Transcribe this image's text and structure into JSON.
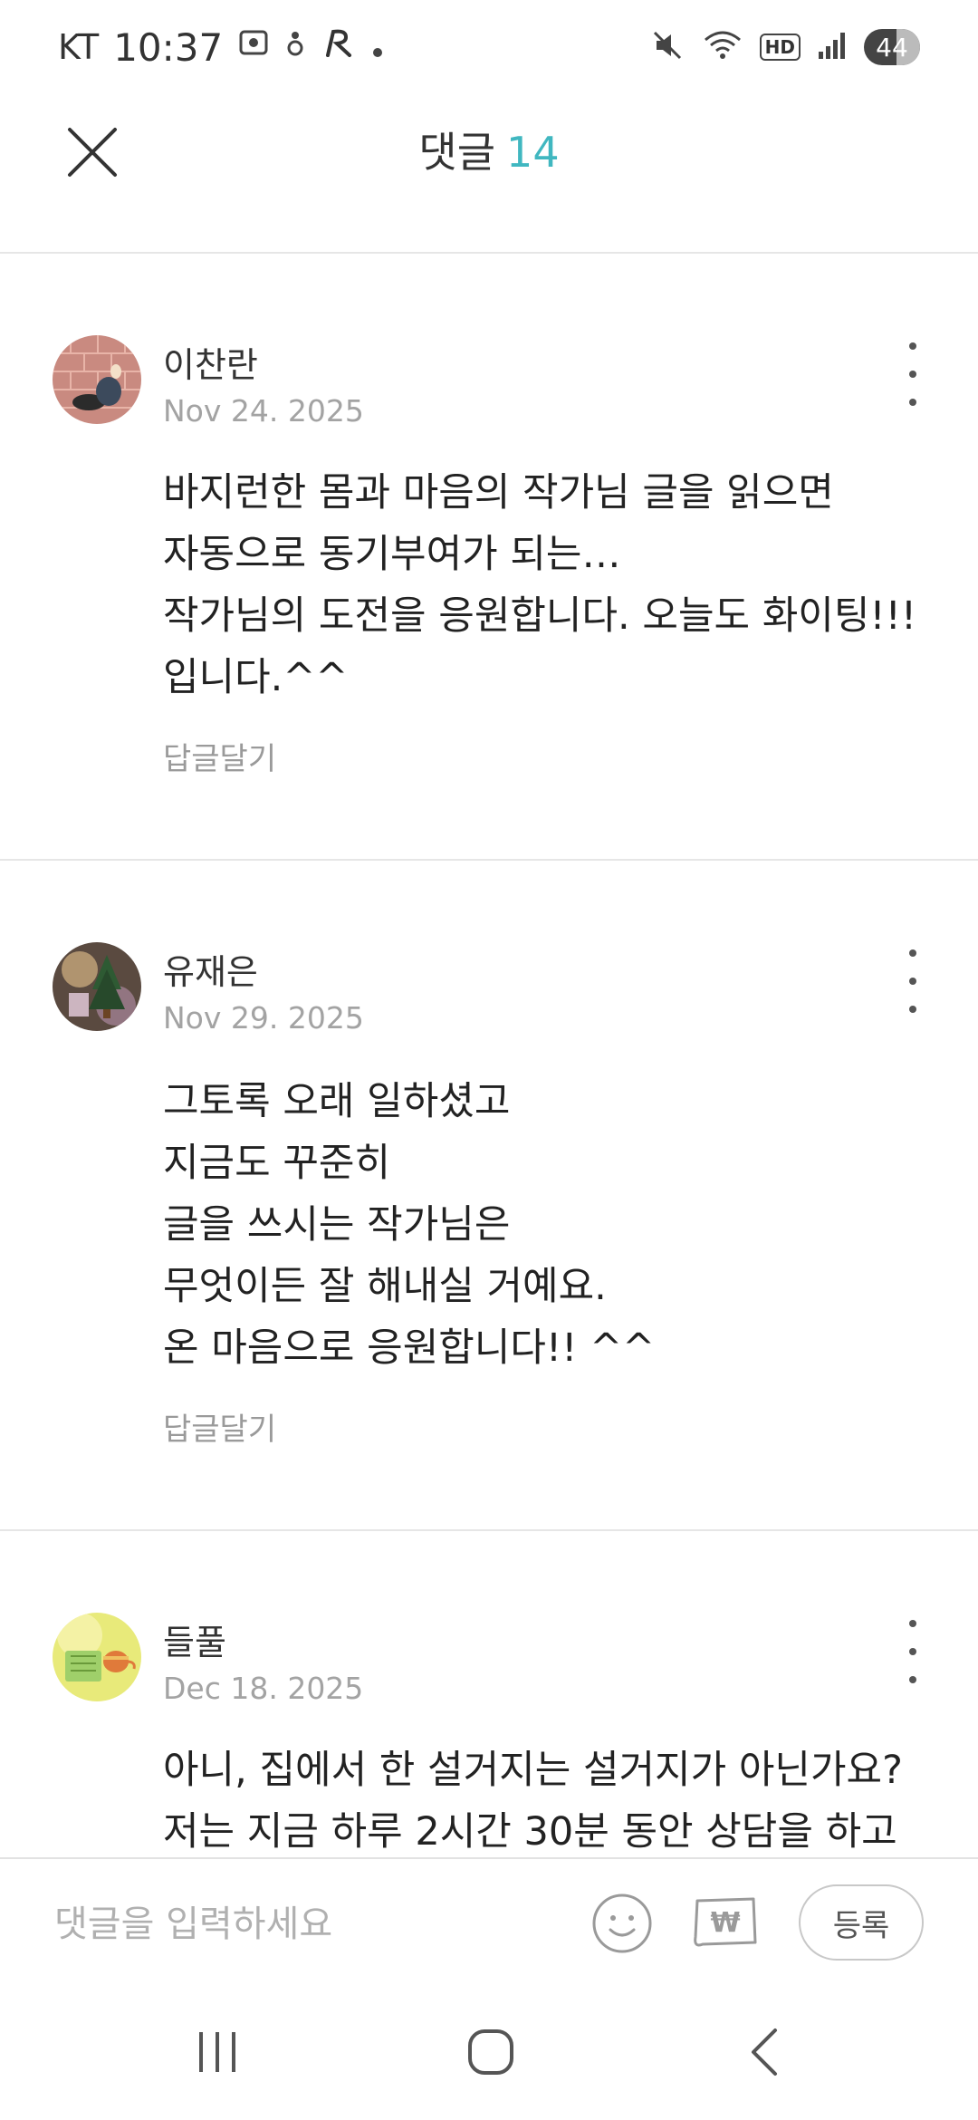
{
  "status_bar": {
    "carrier": "KT",
    "time": "10:37",
    "battery": "44"
  },
  "header": {
    "title": "댓글",
    "count": "14",
    "accent_color": "#40b7c0"
  },
  "comments": [
    {
      "name": "이찬란",
      "date": "Nov 24. 2025",
      "lines": [
        "바지런한 몸과 마음의 작가님 글을 읽으면",
        "자동으로 동기부여가 되는…",
        "작가님의 도전을 응원합니다. 오늘도 화이팅!!!",
        "입니다.^^"
      ],
      "reply_label": "답글달기"
    },
    {
      "name": "유재은",
      "date": "Nov 29. 2025",
      "lines": [
        "그토록 오래 일하셨고",
        "지금도 꾸준히",
        "글을 쓰시는 작가님은",
        "무엇이든 잘 해내실 거예요.",
        "온 마음으로 응원합니다!! ^^"
      ],
      "reply_label": "답글달기"
    },
    {
      "name": "들풀",
      "date": "Dec 18. 2025",
      "lines": [
        "아니, 집에서 한 설거지는 설거지가 아닌가요?",
        "저는 지금 하루 2시간 30분 동안 상담을 하고"
      ],
      "reply_label": ""
    }
  ],
  "input": {
    "placeholder": "댓글을 입력하세요",
    "submit_label": "등록"
  },
  "icons": {
    "close": "close-icon",
    "more": "more-vertical-icon",
    "emoji": "emoji-icon",
    "sticker": "sticker-icon",
    "recent": "recent-apps-icon",
    "home": "home-icon",
    "back": "back-icon"
  }
}
